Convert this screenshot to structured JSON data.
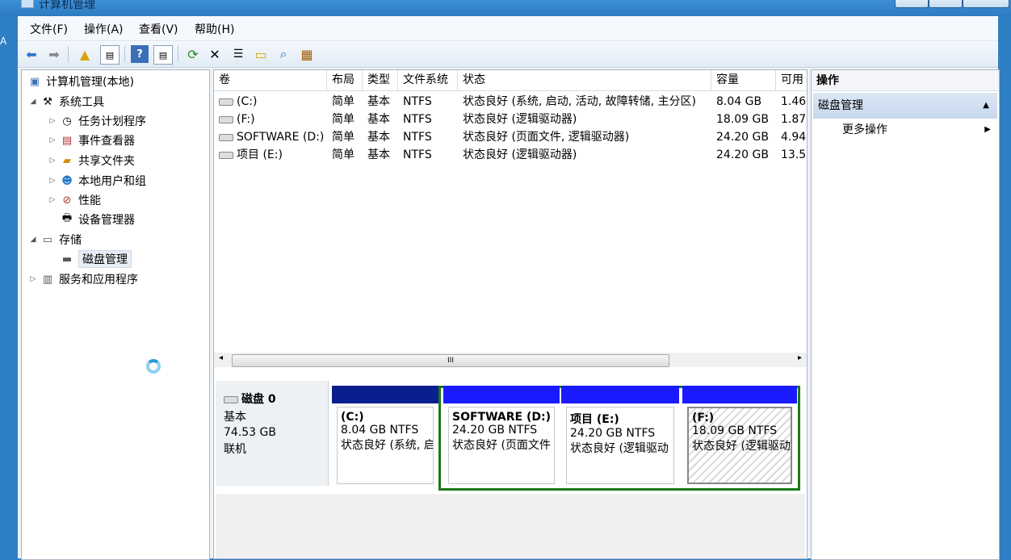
{
  "window": {
    "title": "计算机管理",
    "desktop_glyph": "A"
  },
  "menu": [
    "文件(F)",
    "操作(A)",
    "查看(V)",
    "帮助(H)"
  ],
  "toolbar_icons": [
    "back-icon",
    "forward-icon",
    "up-icon",
    "show-hide-tree-icon",
    "help-icon",
    "show-hide-action-icon",
    "refresh-icon",
    "delete-icon",
    "properties-icon",
    "open-icon",
    "search-icon",
    "disk-settings-icon"
  ],
  "tree": {
    "root": "计算机管理(本地)",
    "system_tools": "系统工具",
    "task_scheduler": "任务计划程序",
    "event_viewer": "事件查看器",
    "shared_folders": "共享文件夹",
    "local_users": "本地用户和组",
    "performance": "性能",
    "device_manager": "设备管理器",
    "storage": "存储",
    "disk_management": "磁盘管理",
    "services": "服务和应用程序"
  },
  "volumes": {
    "headers": [
      "卷",
      "布局",
      "类型",
      "文件系统",
      "状态",
      "容量",
      "可用"
    ],
    "rows": [
      {
        "vol": "(C:)",
        "layout": "简单",
        "type": "基本",
        "fs": "NTFS",
        "status": "状态良好 (系统, 启动, 活动, 故障转储, 主分区)",
        "capacity": "8.04 GB",
        "free": "1.46"
      },
      {
        "vol": "(F:)",
        "layout": "简单",
        "type": "基本",
        "fs": "NTFS",
        "status": "状态良好 (逻辑驱动器)",
        "capacity": "18.09 GB",
        "free": "1.87"
      },
      {
        "vol": "SOFTWARE (D:)",
        "layout": "简单",
        "type": "基本",
        "fs": "NTFS",
        "status": "状态良好 (页面文件, 逻辑驱动器)",
        "capacity": "24.20 GB",
        "free": "4.94"
      },
      {
        "vol": "项目 (E:)",
        "layout": "简单",
        "type": "基本",
        "fs": "NTFS",
        "status": "状态良好 (逻辑驱动器)",
        "capacity": "24.20 GB",
        "free": "13.5"
      }
    ],
    "scroll_glyph": "III"
  },
  "disk": {
    "name": "磁盘 0",
    "type": "基本",
    "size": "74.53 GB",
    "state": "联机",
    "partitions": [
      {
        "name": "(C:)",
        "size": "8.04 GB NTFS",
        "status": "状态良好 (系统, 启",
        "color": "#0a1f8f"
      },
      {
        "name": "SOFTWARE  (D:)",
        "size": "24.20 GB NTFS",
        "status": "状态良好 (页面文件",
        "color": "#1a1aff"
      },
      {
        "name": "项目  (E:)",
        "size": "24.20 GB NTFS",
        "status": "状态良好 (逻辑驱动",
        "color": "#1a1aff"
      },
      {
        "name": "(F:)",
        "size": "18.09 GB NTFS",
        "status": "状态良好 (逻辑驱动",
        "color": "#1a1aff"
      }
    ]
  },
  "actions": {
    "header": "操作",
    "section": "磁盘管理",
    "more": "更多操作"
  }
}
